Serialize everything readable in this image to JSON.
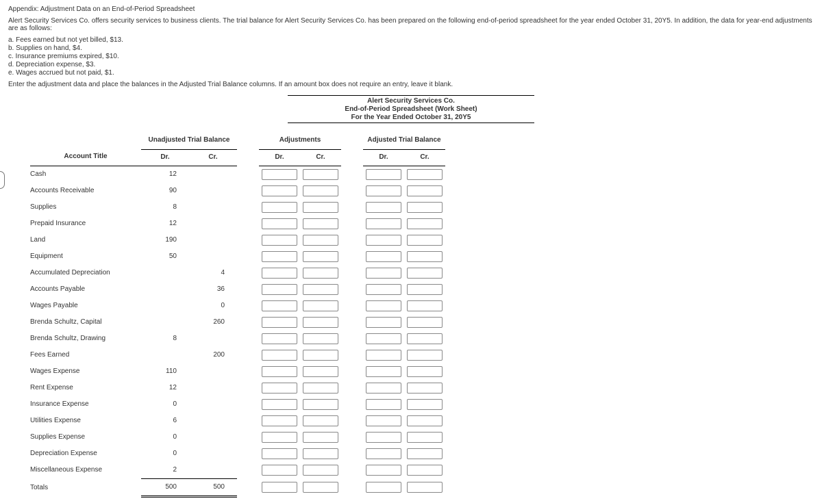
{
  "title": "Appendix: Adjustment Data on an End-of-Period Spreadsheet",
  "intro": "Alert Security Services Co. offers security services to business clients. The trial balance for Alert Security Services Co. has been prepared on the following end-of-period spreadsheet for the year ended October 31, 20Y5. In addition, the data for year-end adjustments are as follows:",
  "adj": {
    "a": "a. Fees earned but not yet billed, $13.",
    "b": "b. Supplies on hand, $4.",
    "c": "c. Insurance premiums expired, $10.",
    "d": "d. Depreciation expense, $3.",
    "e": "e. Wages accrued but not paid, $1."
  },
  "instr": "Enter the adjustment data and place the balances in the Adjusted Trial Balance columns.  If an amount box does not require an entry, leave it blank.",
  "header": {
    "company": "Alert Security Services Co.",
    "doc": "End-of-Period Spreadsheet (Work Sheet)",
    "period": "For the Year Ended October 31, 20Y5"
  },
  "cols": {
    "account": "Account Title",
    "utb": "Unadjusted Trial Balance",
    "adj": "Adjustments",
    "atb": "Adjusted Trial Balance",
    "dr": "Dr.",
    "cr": "Cr."
  },
  "rows": [
    {
      "title": "Cash",
      "dr": "12",
      "cr": ""
    },
    {
      "title": "Accounts Receivable",
      "dr": "90",
      "cr": ""
    },
    {
      "title": "Supplies",
      "dr": "8",
      "cr": ""
    },
    {
      "title": "Prepaid Insurance",
      "dr": "12",
      "cr": ""
    },
    {
      "title": "Land",
      "dr": "190",
      "cr": ""
    },
    {
      "title": "Equipment",
      "dr": "50",
      "cr": ""
    },
    {
      "title": "Accumulated Depreciation",
      "dr": "",
      "cr": "4"
    },
    {
      "title": "Accounts Payable",
      "dr": "",
      "cr": "36"
    },
    {
      "title": "Wages Payable",
      "dr": "",
      "cr": "0"
    },
    {
      "title": "Brenda Schultz, Capital",
      "dr": "",
      "cr": "260"
    },
    {
      "title": "Brenda Schultz, Drawing",
      "dr": "8",
      "cr": ""
    },
    {
      "title": "Fees Earned",
      "dr": "",
      "cr": "200"
    },
    {
      "title": "Wages Expense",
      "dr": "110",
      "cr": ""
    },
    {
      "title": "Rent Expense",
      "dr": "12",
      "cr": ""
    },
    {
      "title": "Insurance Expense",
      "dr": "0",
      "cr": ""
    },
    {
      "title": "Utilities Expense",
      "dr": "6",
      "cr": ""
    },
    {
      "title": "Supplies Expense",
      "dr": "0",
      "cr": ""
    },
    {
      "title": "Depreciation Expense",
      "dr": "0",
      "cr": ""
    },
    {
      "title": "Miscellaneous Expense",
      "dr": "2",
      "cr": ""
    }
  ],
  "totals": {
    "title": "Totals",
    "dr": "500",
    "cr": "500"
  }
}
